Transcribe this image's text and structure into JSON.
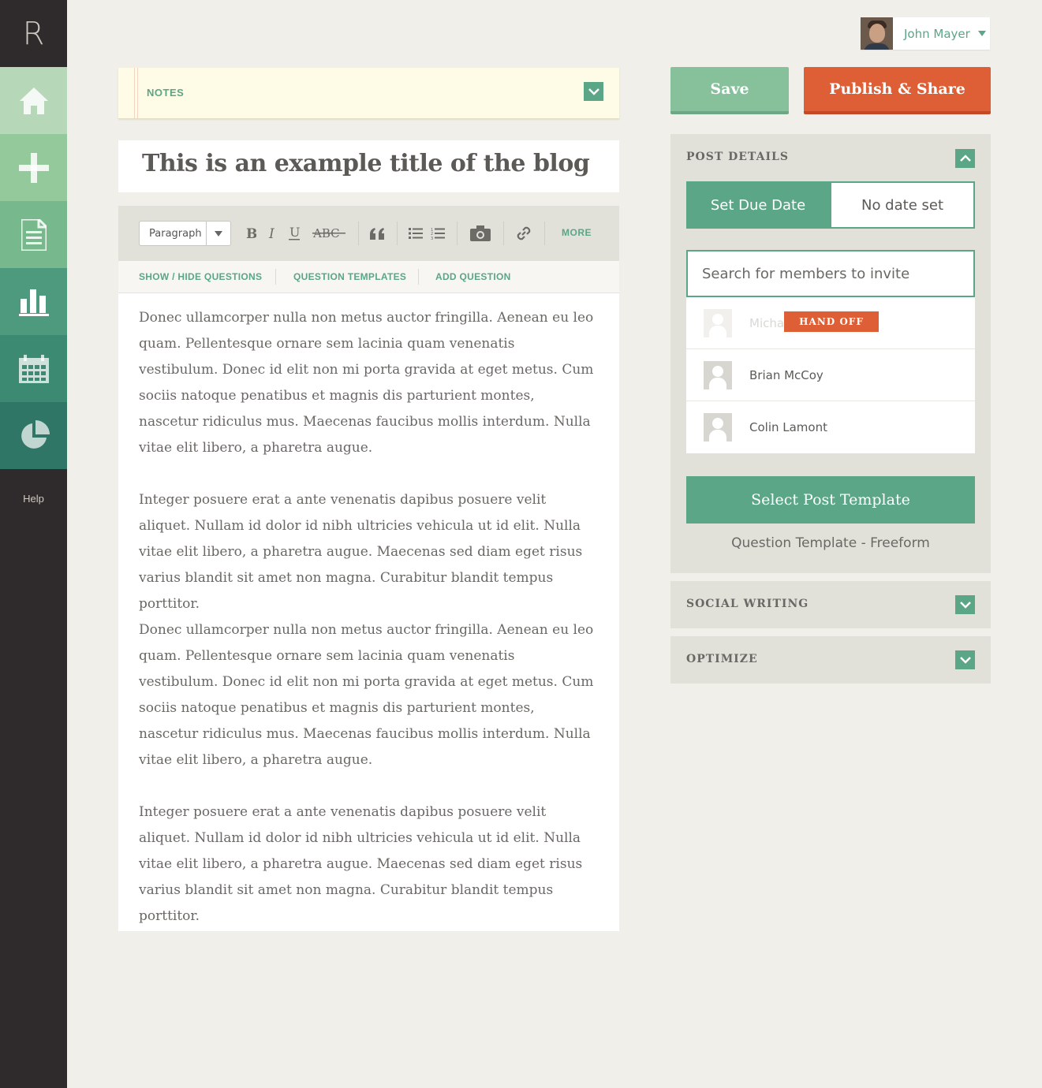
{
  "app": {
    "logo": "R"
  },
  "sidebar": {
    "items": [
      {
        "icon": "home-icon",
        "color": "#b6d8b8"
      },
      {
        "icon": "plus-icon",
        "color": "#94c99c"
      },
      {
        "icon": "document-icon",
        "color": "#77b98c"
      },
      {
        "icon": "bar-chart-icon",
        "color": "#4d9a7e"
      },
      {
        "icon": "calendar-icon",
        "color": "#3d8a72"
      },
      {
        "icon": "pie-chart-icon",
        "color": "#2f7666"
      }
    ],
    "help": "Help"
  },
  "user": {
    "name": "John Mayer"
  },
  "notes": {
    "label": "NOTES"
  },
  "editor": {
    "title": "This is an example title of the blog",
    "format": "Paragraph",
    "more": "MORE",
    "sub_links": [
      "SHOW / HIDE QUESTIONS",
      "QUESTION TEMPLATES",
      "ADD QUESTION"
    ],
    "paragraphs": [
      "Donec ullamcorper nulla non metus auctor fringilla. Aenean eu leo quam. Pellentesque ornare sem lacinia quam venenatis vestibulum. Donec id elit non mi porta gravida at eget metus. Cum sociis natoque penatibus et magnis dis parturient montes, nascetur ridiculus mus. Maecenas faucibus mollis interdum. Nulla vitae elit libero, a pharetra augue.",
      "Integer posuere erat a ante venenatis dapibus posuere velit aliquet. Nullam id dolor id nibh ultricies vehicula ut id elit. Nulla vitae elit libero, a pharetra augue. Maecenas sed diam eget risus varius blandit sit amet non magna. Curabitur blandit tempus porttitor.",
      "Donec ullamcorper nulla non metus auctor fringilla. Aenean eu leo quam. Pellentesque ornare sem lacinia quam venenatis vestibulum. Donec id elit non mi porta gravida at eget metus. Cum sociis natoque penatibus et magnis dis parturient montes, nascetur ridiculus mus. Maecenas faucibus mollis interdum. Nulla vitae elit libero, a pharetra augue.",
      "Integer posuere erat a ante venenatis dapibus posuere velit aliquet. Nullam id dolor id nibh ultricies vehicula ut id elit. Nulla vitae elit libero, a pharetra augue. Maecenas sed diam eget risus varius blandit sit amet non magna. Curabitur blandit tempus porttitor."
    ]
  },
  "actions": {
    "save": "Save",
    "publish": "Publish & Share"
  },
  "post_details": {
    "title": "POST DETAILS",
    "due_date_button": "Set Due Date",
    "due_date_value": "No date set",
    "search_placeholder": "Search for members to invite",
    "members": [
      {
        "name": "Micha",
        "faded": true,
        "action": "HAND OFF"
      },
      {
        "name": "Brian McCoy"
      },
      {
        "name": "Colin Lamont"
      }
    ],
    "select_template": "Select Post Template",
    "template_caption": "Question Template - Freeform"
  },
  "social_writing": {
    "title": "SOCIAL WRITING"
  },
  "optimize": {
    "title": "OPTIMIZE"
  },
  "colors": {
    "accent": "#5aa687",
    "publish": "#de5f35",
    "save": "#86c19c",
    "sidebar": "#2f2a2b"
  }
}
